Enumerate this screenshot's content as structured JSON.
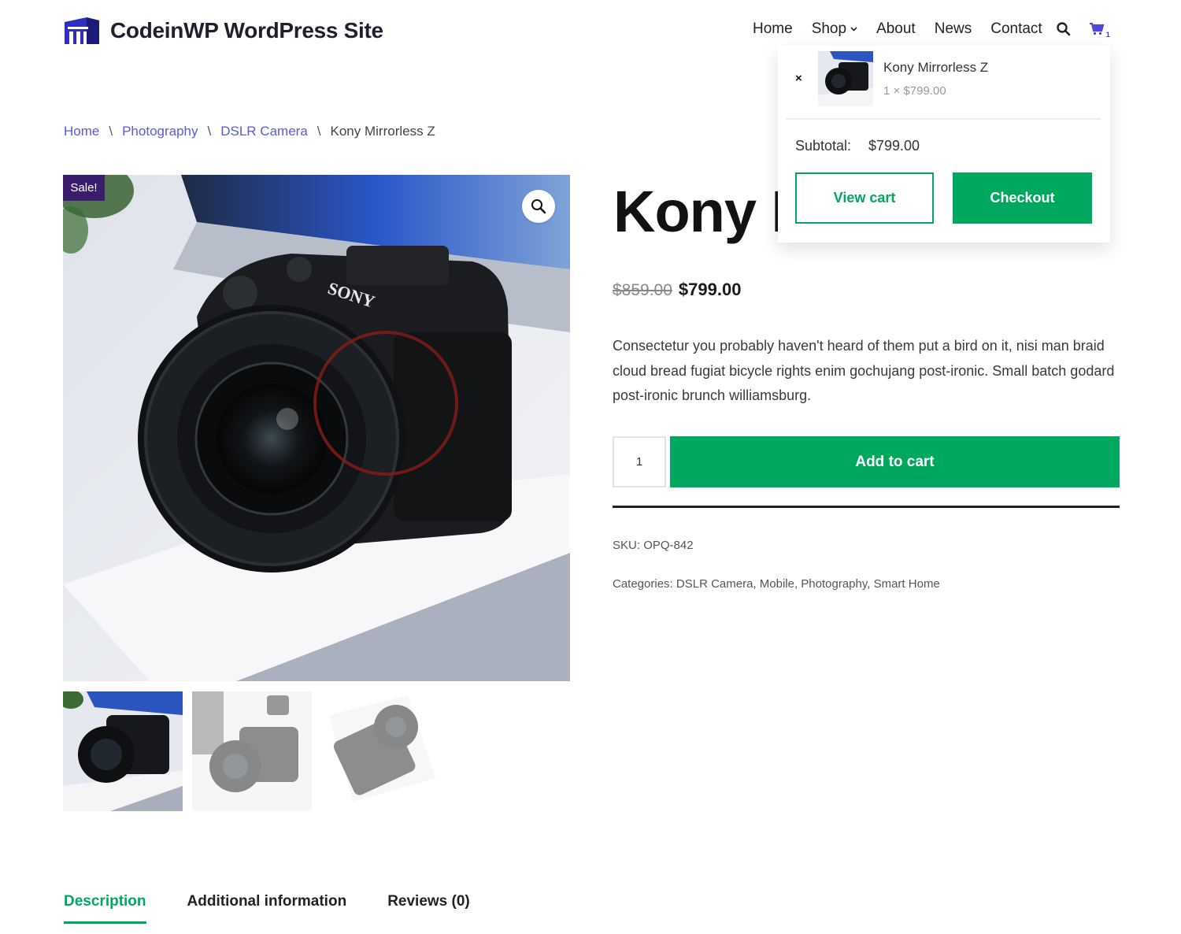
{
  "site": {
    "title": "CodeinWP WordPress Site",
    "accent_color": "#00a85f",
    "link_color": "#5b5bd6",
    "badge_color": "#3b1d6e"
  },
  "nav": {
    "items": [
      {
        "label": "Home"
      },
      {
        "label": "Shop"
      },
      {
        "label": "About"
      },
      {
        "label": "News"
      },
      {
        "label": "Contact"
      }
    ],
    "icons": {
      "search": "search-icon",
      "cart": "cart-icon",
      "dropdown": "chevron-down-icon"
    },
    "cart_count": "1"
  },
  "breadcrumb": {
    "items": [
      "Home",
      "Photography",
      "DSLR Camera"
    ],
    "separator": "\\",
    "current": "Kony Mirrorless Z"
  },
  "product": {
    "sale_badge": "Sale!",
    "title": "Kony Mirrorless Z",
    "old_price": "$859.00",
    "price": "$799.00",
    "description": "Consectetur you probably haven't heard of them put a bird on it, nisi man braid cloud bread fugiat bicycle rights enim gochujang post-ironic. Small batch godard post-ironic brunch williamsburg.",
    "quantity": "1",
    "add_to_cart": "Add to cart",
    "sku_label": "SKU:",
    "sku": "OPQ-842",
    "categories_label": "Categories:",
    "categories": [
      "DSLR Camera",
      "Mobile",
      "Photography",
      "Smart Home"
    ]
  },
  "tabs": [
    {
      "label": "Description",
      "active": true
    },
    {
      "label": "Additional information",
      "active": false
    },
    {
      "label": "Reviews (0)",
      "active": false
    }
  ],
  "mini_cart": {
    "remove_symbol": "×",
    "item_name": "Kony Mirrorless Z",
    "item_qty": "1 × $799.00",
    "subtotal_label": "Subtotal:",
    "subtotal_value": "$799.00",
    "view_cart": "View cart",
    "checkout": "Checkout"
  }
}
